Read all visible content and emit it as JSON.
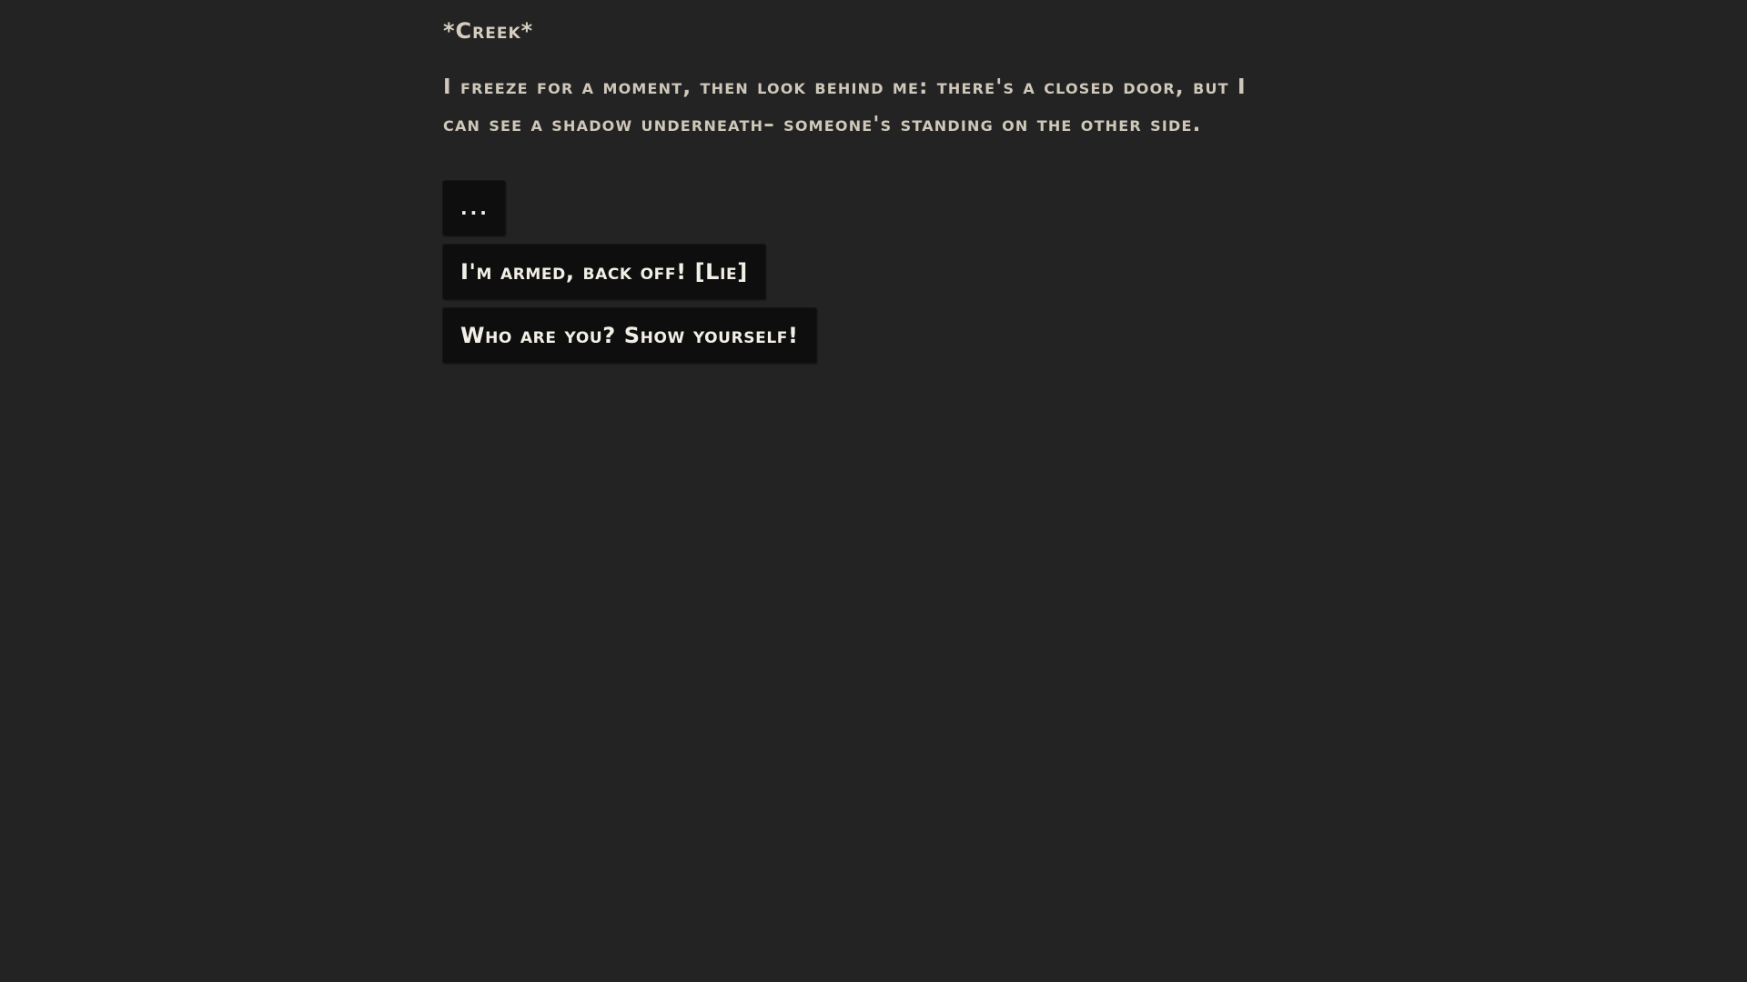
{
  "scene": {
    "sound_effect": "*Creek*",
    "narration": "I freeze for a moment, then look behind me: there's a closed door, but I can see a shadow underneath– someone's standing on the other side."
  },
  "choices": [
    {
      "label": "..."
    },
    {
      "label": "I'm armed, back off! [Lie]"
    },
    {
      "label": "Who are you? Show yourself!"
    }
  ],
  "colors": {
    "background": "#232323",
    "text": "#d2ccbf",
    "choice_background": "#0e0e0e",
    "choice_text": "#f2efe6"
  }
}
